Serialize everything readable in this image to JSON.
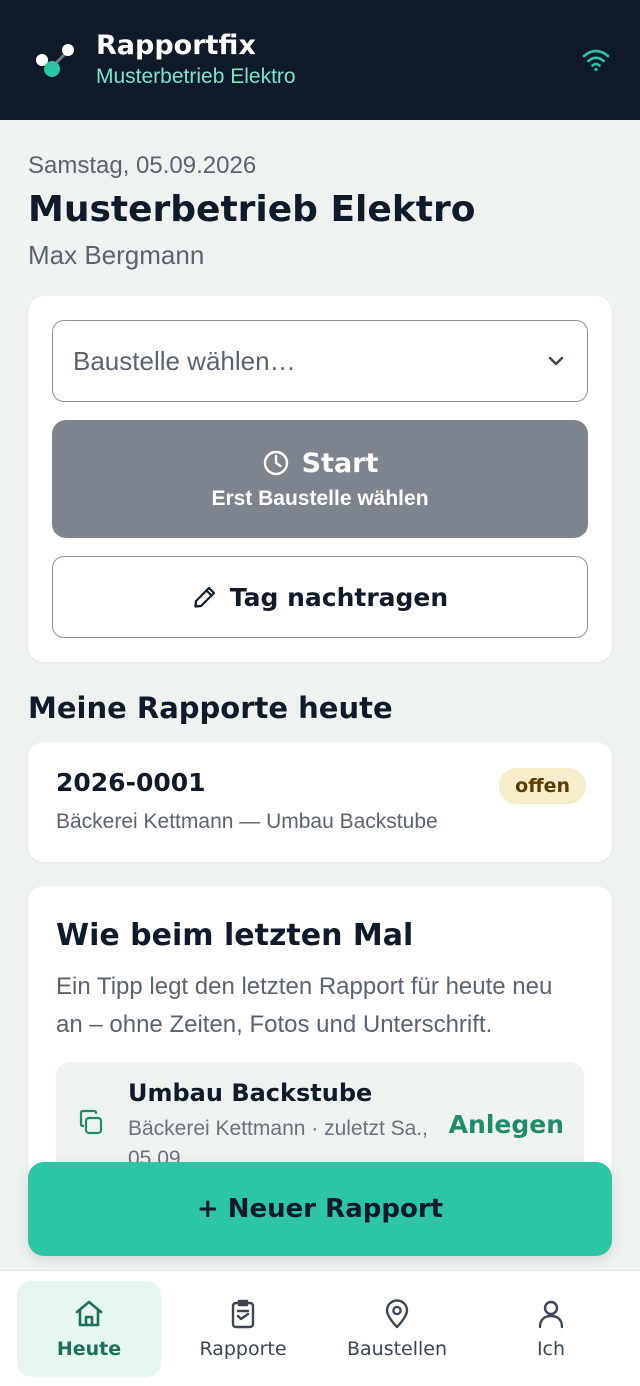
{
  "header": {
    "title": "Rapportfix",
    "subtitle": "Musterbetrieb Elektro",
    "status_icon": "wifi-icon"
  },
  "today": {
    "date": "Samstag, 05.09.2026",
    "company": "Musterbetrieb Elektro",
    "user": "Max Bergmann"
  },
  "start_card": {
    "select_placeholder": "Baustelle wählen…",
    "start_label": "Start",
    "start_hint": "Erst Baustelle wählen",
    "backfill_label": "Tag nachtragen"
  },
  "reports_today": {
    "title": "Meine Rapporte heute",
    "items": [
      {
        "number": "2026-0001",
        "description": "Bäckerei Kettmann — Umbau Backstube",
        "status": "offen"
      }
    ]
  },
  "repeat_tip": {
    "title": "Wie beim letzten Mal",
    "text": "Ein Tipp legt den letzten Rapport für heute neu an – ohne Zeiten, Fotos und Unterschrift.",
    "item": {
      "title": "Umbau Backstube",
      "subtitle": "Bäckerei Kettmann · zuletzt Sa., 05.09.",
      "action": "Anlegen"
    }
  },
  "fab": {
    "label": "+ Neuer Rapport"
  },
  "nav": {
    "items": [
      {
        "label": "Heute",
        "icon": "home-icon",
        "active": true
      },
      {
        "label": "Rapporte",
        "icon": "clipboard-icon",
        "active": false
      },
      {
        "label": "Baustellen",
        "icon": "location-pin-icon",
        "active": false
      },
      {
        "label": "Ich",
        "icon": "user-icon",
        "active": false
      }
    ]
  },
  "colors": {
    "header_bg": "#0f1b2a",
    "accent": "#2ec4a6",
    "badge_bg": "#f6ecc9"
  }
}
